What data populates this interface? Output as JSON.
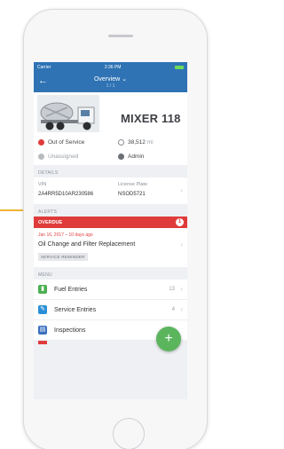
{
  "status_bar": {
    "carrier": "Carrier",
    "time": "2:36 PM"
  },
  "nav": {
    "back_icon": "arrow-left-icon",
    "title": "Overview",
    "title_caret": "⌄",
    "subtitle": "1 / 1"
  },
  "asset": {
    "name": "MIXER 118",
    "status": "Out of Service",
    "status_color": "#e03b3b",
    "meter_value": "38,512",
    "meter_unit": "mi",
    "assignment": "Unassigned",
    "group": "Admin"
  },
  "details": {
    "section_label": "DETAILS",
    "vin_label": "VIN",
    "vin": "2A4RR5D10AR230586",
    "plate_label": "License Plate",
    "plate": "NSOD5721"
  },
  "alerts": {
    "section_label": "ALERTS",
    "overdue_label": "OVERDUE",
    "overdue_count": "1",
    "due_text": "Jan 16, 2017 – 10 days ago",
    "reminder_name": "Oil Change and Filter Replacement",
    "reminder_tag": "SERVICE REMINDER"
  },
  "menu": {
    "section_label": "MENU",
    "items": [
      {
        "label": "Fuel Entries",
        "count": "13",
        "color": "#4caf50",
        "icon": "fuel-icon"
      },
      {
        "label": "Service Entries",
        "count": "4",
        "color": "#2b8fd6",
        "icon": "wrench-icon"
      },
      {
        "label": "Inspections",
        "count": "",
        "color": "#3a6fbf",
        "icon": "clipboard-icon"
      }
    ]
  },
  "fab": {
    "icon": "plus-icon",
    "label": "+"
  },
  "colors": {
    "primary": "#2f73b4",
    "danger": "#e03b3b",
    "success": "#5bb55d",
    "accent_connector": "#f2b233"
  }
}
